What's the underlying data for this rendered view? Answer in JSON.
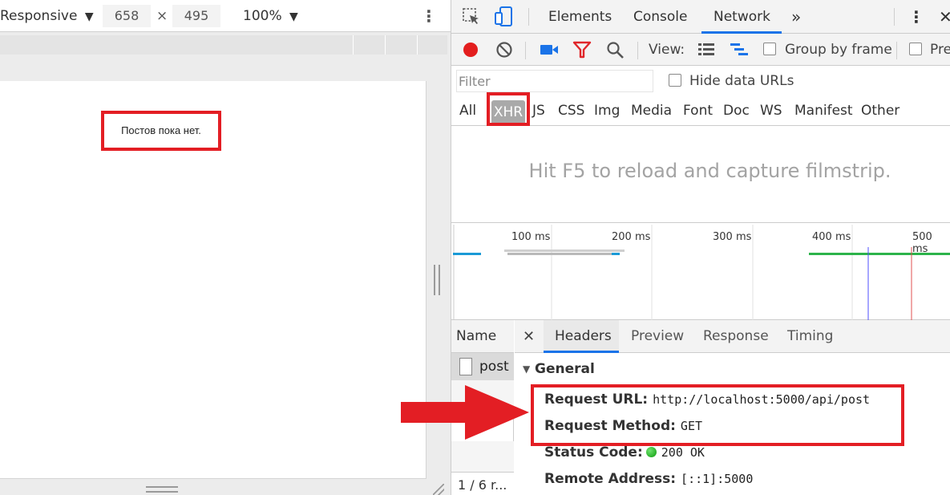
{
  "device_toolbar": {
    "device": "Responsive",
    "device_caret": "▼",
    "width": "658",
    "times": "×",
    "height": "495",
    "zoom": "100%",
    "zoom_caret": "▼",
    "menu_icon": "vertical-dots-icon",
    "menu_glyph": "⋮"
  },
  "page": {
    "empty_message": "Постов пока нет."
  },
  "devtools": {
    "tabs": {
      "elements": "Elements",
      "console": "Console",
      "network": "Network",
      "more": "»"
    },
    "active_tab": "Network",
    "menu_glyph": "⋮",
    "close_glyph": "✕",
    "toolbar": {
      "view_label": "View:",
      "group_by_frame": "Group by frame",
      "preserve_log": "Pre",
      "record_color": "#e31e1e",
      "filter_color": "#e0262a",
      "camera_color": "#1a73e8"
    },
    "filter": {
      "placeholder": "Filter",
      "hide_data_urls": "Hide data URLs"
    },
    "types": [
      "All",
      "XHR",
      "JS",
      "CSS",
      "Img",
      "Media",
      "Font",
      "Doc",
      "WS",
      "Manifest",
      "Other"
    ],
    "active_type": "XHR",
    "filmstrip_hint": "Hit F5 to reload and capture filmstrip.",
    "timeline_ticks": [
      "100 ms",
      "200 ms",
      "300 ms",
      "400 ms",
      "500 ms"
    ],
    "name_column": {
      "header": "Name",
      "rows": [
        "post"
      ],
      "footer": "1 / 6 r..."
    },
    "detail_tabs": {
      "close": "✕",
      "headers": "Headers",
      "preview": "Preview",
      "response": "Response",
      "timing": "Timing"
    },
    "general": {
      "title": "General",
      "arrow": "▼",
      "request_url_label": "Request URL:",
      "request_url": "http://localhost:5000/api/post",
      "request_method_label": "Request Method:",
      "request_method": "GET",
      "status_code_label": "Status Code:",
      "status_code": "200 OK",
      "remote_address_label": "Remote Address:",
      "remote_address": "[::1]:5000"
    }
  },
  "annotations": {
    "highlight_color": "#e31e24"
  }
}
